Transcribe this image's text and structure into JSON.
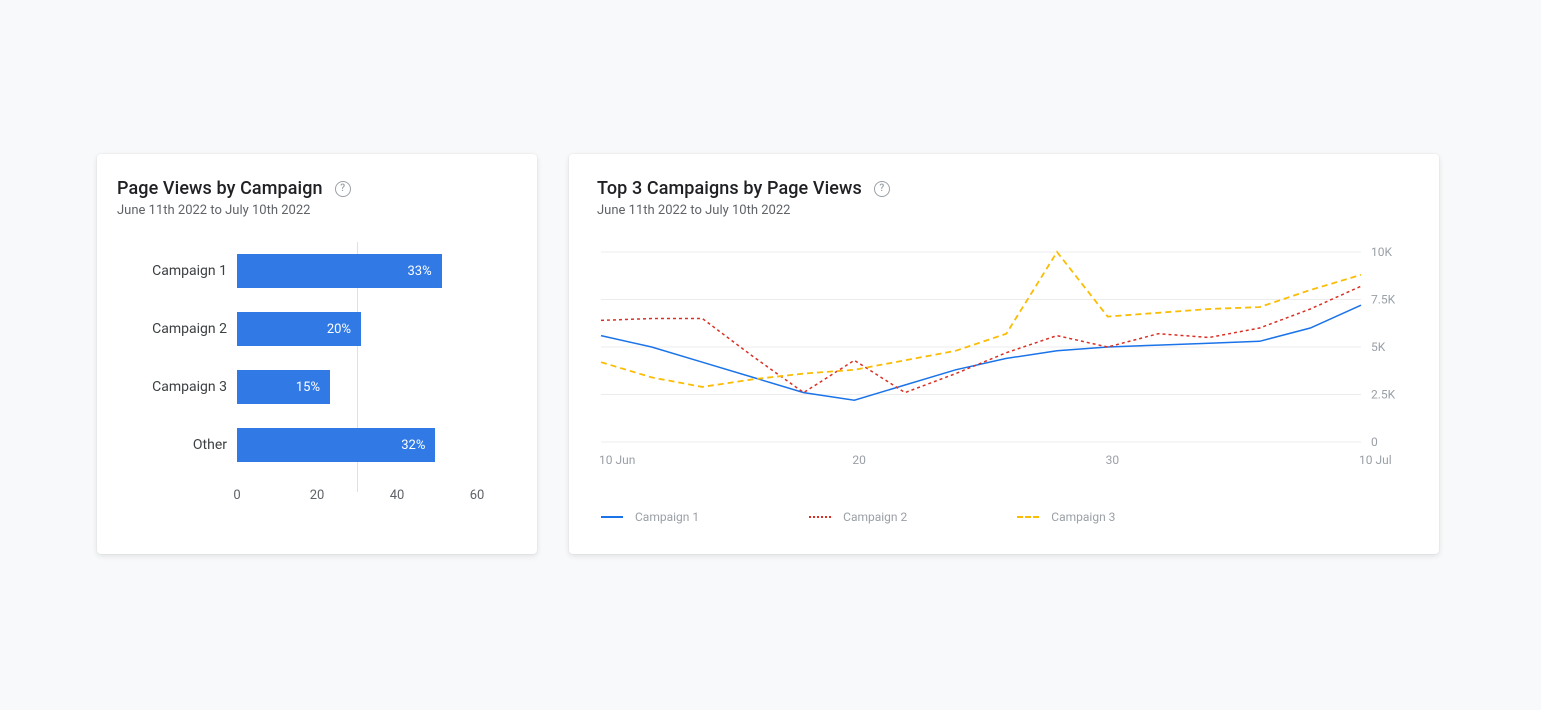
{
  "bar_card": {
    "title": "Page Views by Campaign",
    "subtitle": "June 11th 2022 to July 10th 2022",
    "help_glyph": "?"
  },
  "line_card": {
    "title": "Top 3 Campaigns by Page Views",
    "subtitle": "June 11th 2022 to July 10th 2022",
    "help_glyph": "?"
  },
  "legend": {
    "s1": "Campaign 1",
    "s2": "Campaign 2",
    "s3": "Campaign 3"
  },
  "chart_data": [
    {
      "type": "bar",
      "orientation": "horizontal",
      "title": "Page Views by Campaign",
      "subtitle": "June 11th 2022 to July 10th 2022",
      "categories": [
        "Campaign 1",
        "Campaign 2",
        "Campaign 3",
        "Other"
      ],
      "values": [
        33,
        20,
        15,
        32
      ],
      "value_labels": [
        "33%",
        "20%",
        "15%",
        "32%"
      ],
      "xlabel": "",
      "ylabel": "",
      "xlim": [
        0,
        60
      ],
      "x_ticks": [
        0,
        20,
        40,
        60
      ],
      "bar_color": "#317ae6"
    },
    {
      "type": "line",
      "title": "Top 3 Campaigns by Page Views",
      "subtitle": "June 11th 2022 to July 10th 2022",
      "x": [
        10,
        12,
        14,
        16,
        18,
        20,
        22,
        24,
        26,
        28,
        30,
        32,
        34,
        36,
        38,
        40
      ],
      "x_tick_labels": [
        "10 Jun",
        "20",
        "30",
        "10 Jul"
      ],
      "x_tick_positions": [
        10,
        20,
        30,
        40
      ],
      "ylim": [
        0,
        10000
      ],
      "y_ticks": [
        0,
        2500,
        5000,
        7500,
        10000
      ],
      "y_tick_labels": [
        "0",
        "2.5K",
        "5K",
        "7.5K",
        "10K"
      ],
      "series": [
        {
          "name": "Campaign 1",
          "color": "#1a73e8",
          "style": "solid",
          "values": [
            5600,
            5000,
            4200,
            3400,
            2600,
            2200,
            3000,
            3800,
            4400,
            4800,
            5000,
            5100,
            5200,
            5300,
            6000,
            7200
          ]
        },
        {
          "name": "Campaign 2",
          "color": "#d93025",
          "style": "dotted",
          "values": [
            6400,
            6500,
            6500,
            4500,
            2600,
            4300,
            2600,
            3600,
            4700,
            5600,
            5000,
            5700,
            5500,
            6000,
            7000,
            8200
          ]
        },
        {
          "name": "Campaign 3",
          "color": "#fbbc04",
          "style": "dashed",
          "values": [
            4200,
            3400,
            2900,
            3300,
            3600,
            3800,
            4300,
            4800,
            5700,
            10000,
            6600,
            6800,
            7000,
            7100,
            8000,
            8800
          ]
        }
      ]
    }
  ]
}
